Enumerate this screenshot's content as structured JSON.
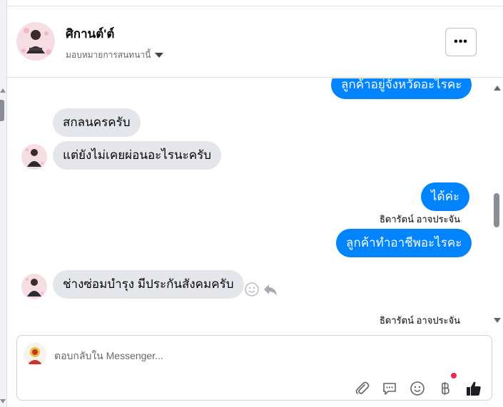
{
  "header": {
    "name": "ศิกานต์'ต์",
    "subtitle": "มอบหมายการสนทนานี้",
    "more_label": "•••"
  },
  "thread": {
    "messages": [
      {
        "direction": "out",
        "text": "ลูกค้าอยู่จังหวัดอะไรคะ"
      },
      {
        "direction": "in",
        "text": "สกลนครครับ"
      },
      {
        "direction": "in",
        "text": "แต่ยังไม่เคยผ่อนอะไรนะครับ"
      },
      {
        "direction": "out",
        "text": "ได้ค่ะ"
      },
      {
        "direction": "out",
        "sender": "ธิดารัตน์ อาจประจัน",
        "text": "ลูกค้าทำอาชีพอะไรคะ"
      },
      {
        "direction": "in",
        "text": "ช่างซ่อมบำรุง มีประกันสังคมครับ"
      }
    ],
    "footer_sender": "ธิดารัตน์ อาจประจัน"
  },
  "composer": {
    "placeholder": "ตอบกลับใน Messenger...",
    "icons": [
      "paperclip-icon",
      "saved-reply-icon",
      "emoji-icon",
      "baht-payment-icon",
      "thumbs-up-icon"
    ]
  },
  "colors": {
    "outgoing_bubble": "#0084ff",
    "incoming_bubble": "#e4e6eb",
    "notification_dot": "#f02849"
  }
}
